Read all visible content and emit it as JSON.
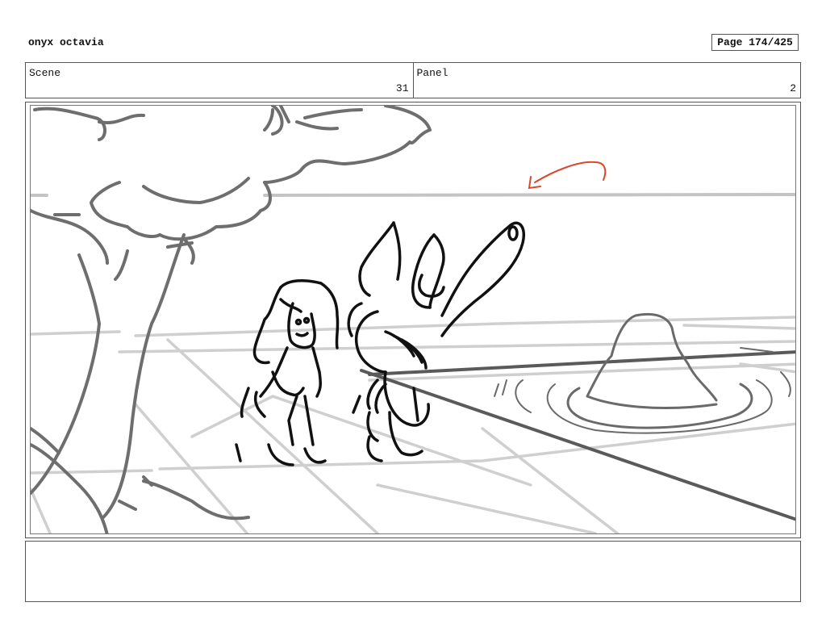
{
  "header": {
    "author": "onyx octavia",
    "page": "Page 174/425"
  },
  "info": {
    "scene_label": "Scene",
    "scene_value": "31",
    "panel_label": "Panel",
    "panel_value": "2"
  },
  "panel_image": {
    "subject": "storyboard-sketch",
    "accent_color": "#d9482b"
  },
  "notes": ""
}
